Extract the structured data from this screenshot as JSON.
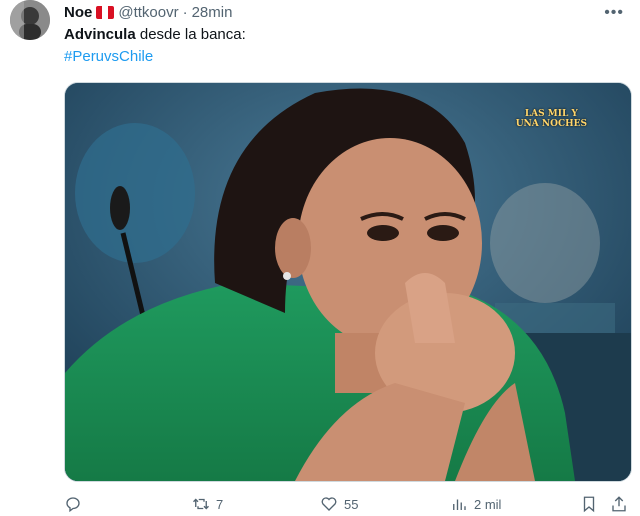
{
  "author": {
    "display_name": "Noe",
    "flag": "peru-flag-icon",
    "handle": "@ttkoovr",
    "separator": "·",
    "time": "28min"
  },
  "tweet": {
    "bold_text": "Advincula",
    "text": " desde la banca:",
    "hashtag": "#PeruvsChile"
  },
  "media": {
    "watermark_line1": "LAS MIL Y",
    "watermark_line2": "UNA NOCHES"
  },
  "actions": {
    "reply_icon": "reply-icon",
    "retweet_count": "7",
    "like_count": "55",
    "views_count": "2 mil",
    "bookmark_icon": "bookmark-icon",
    "share_icon": "share-icon"
  },
  "colors": {
    "accent": "#1d9bf0",
    "muted": "#536471",
    "text": "#0f1419"
  }
}
